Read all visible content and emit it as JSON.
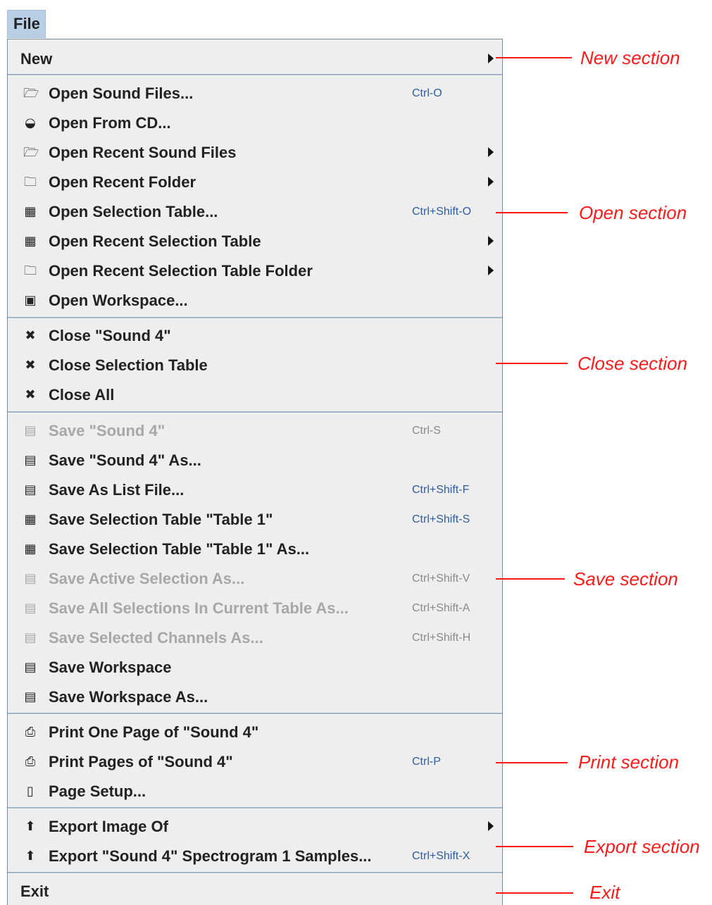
{
  "menu": {
    "title": "File",
    "items": [
      {
        "label": "New",
        "icon": "",
        "shortcut": "",
        "submenu": true,
        "disabled": false
      },
      {
        "label": "Open Sound Files...",
        "icon": "open-sound-file-icon",
        "shortcut": "Ctrl-O",
        "submenu": false,
        "disabled": false
      },
      {
        "label": "Open From CD...",
        "icon": "cd-icon",
        "shortcut": "",
        "submenu": false,
        "disabled": false
      },
      {
        "label": "Open Recent Sound Files",
        "icon": "open-sound-file-icon",
        "shortcut": "",
        "submenu": true,
        "disabled": false
      },
      {
        "label": "Open Recent Folder",
        "icon": "folder-icon",
        "shortcut": "",
        "submenu": true,
        "disabled": false
      },
      {
        "label": "Open Selection Table...",
        "icon": "table-icon",
        "shortcut": "Ctrl+Shift-O",
        "submenu": false,
        "disabled": false
      },
      {
        "label": "Open Recent Selection Table",
        "icon": "table-icon",
        "shortcut": "",
        "submenu": true,
        "disabled": false
      },
      {
        "label": "Open Recent Selection Table Folder",
        "icon": "folder-icon",
        "shortcut": "",
        "submenu": true,
        "disabled": false
      },
      {
        "label": "Open Workspace...",
        "icon": "workspace-icon",
        "shortcut": "",
        "submenu": false,
        "disabled": false
      },
      {
        "label": "Close \"Sound 4\"",
        "icon": "close-icon",
        "shortcut": "",
        "submenu": false,
        "disabled": false
      },
      {
        "label": "Close Selection Table",
        "icon": "close-icon",
        "shortcut": "",
        "submenu": false,
        "disabled": false
      },
      {
        "label": "Close All",
        "icon": "close-all-icon",
        "shortcut": "",
        "submenu": false,
        "disabled": false
      },
      {
        "label": "Save \"Sound 4\"",
        "icon": "save-icon",
        "shortcut": "Ctrl-S",
        "submenu": false,
        "disabled": true
      },
      {
        "label": "Save \"Sound 4\" As...",
        "icon": "save-as-icon",
        "shortcut": "",
        "submenu": false,
        "disabled": false
      },
      {
        "label": "Save As List File...",
        "icon": "save-list-icon",
        "shortcut": "Ctrl+Shift-F",
        "submenu": false,
        "disabled": false
      },
      {
        "label": "Save Selection Table \"Table 1\"",
        "icon": "save-table-icon",
        "shortcut": "Ctrl+Shift-S",
        "submenu": false,
        "disabled": false
      },
      {
        "label": "Save Selection Table \"Table 1\" As...",
        "icon": "save-table-icon",
        "shortcut": "",
        "submenu": false,
        "disabled": false
      },
      {
        "label": "Save Active Selection As...",
        "icon": "save-selection-icon",
        "shortcut": "Ctrl+Shift-V",
        "submenu": false,
        "disabled": true
      },
      {
        "label": "Save All Selections In Current Table As...",
        "icon": "save-selections-icon",
        "shortcut": "Ctrl+Shift-A",
        "submenu": false,
        "disabled": true
      },
      {
        "label": "Save Selected Channels As...",
        "icon": "save-channels-icon",
        "shortcut": "Ctrl+Shift-H",
        "submenu": false,
        "disabled": true
      },
      {
        "label": "Save Workspace",
        "icon": "save-workspace-icon",
        "shortcut": "",
        "submenu": false,
        "disabled": false
      },
      {
        "label": "Save Workspace As...",
        "icon": "save-workspace-icon",
        "shortcut": "",
        "submenu": false,
        "disabled": false
      },
      {
        "label": "Print One Page of \"Sound 4\"",
        "icon": "print-icon",
        "shortcut": "",
        "submenu": false,
        "disabled": false
      },
      {
        "label": "Print Pages of \"Sound 4\"",
        "icon": "print-pages-icon",
        "shortcut": "Ctrl-P",
        "submenu": false,
        "disabled": false
      },
      {
        "label": "Page Setup...",
        "icon": "page-setup-icon",
        "shortcut": "",
        "submenu": false,
        "disabled": false
      },
      {
        "label": "Export Image Of",
        "icon": "export-icon",
        "shortcut": "",
        "submenu": true,
        "disabled": false
      },
      {
        "label": "Export \"Sound 4\" Spectrogram 1 Samples...",
        "icon": "export-icon",
        "shortcut": "Ctrl+Shift-X",
        "submenu": false,
        "disabled": false
      },
      {
        "label": "Exit",
        "icon": "",
        "shortcut": "",
        "submenu": false,
        "disabled": false
      }
    ]
  },
  "annotations": [
    {
      "text": "New section"
    },
    {
      "text": "Open section"
    },
    {
      "text": "Close section"
    },
    {
      "text": "Save section"
    },
    {
      "text": "Print section"
    },
    {
      "text": "Export section"
    },
    {
      "text": "Exit"
    }
  ],
  "colors": {
    "annotation": "#ff1a1a",
    "shortcut": "#2e5d9e",
    "disabled": "#a7a7a7",
    "menu_background": "#eeeeee",
    "title_highlight": "#b8cfe5"
  }
}
